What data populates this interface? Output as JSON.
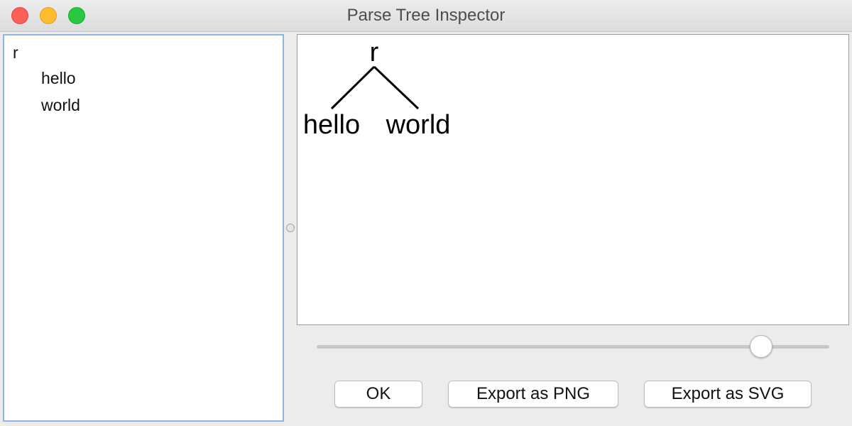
{
  "window": {
    "title": "Parse Tree Inspector"
  },
  "tree_list": {
    "root": "r",
    "children": [
      "hello",
      "world"
    ]
  },
  "tree_view": {
    "root_label": "r",
    "left_child_label": "hello",
    "right_child_label": "world"
  },
  "zoom_slider": {
    "value_fraction": 0.87
  },
  "buttons": {
    "ok": "OK",
    "export_png": "Export as PNG",
    "export_svg": "Export as SVG"
  },
  "colors": {
    "close": "#fd5f57",
    "minimize": "#fdbc2e",
    "zoom": "#28c840",
    "tree_pane_border": "#8fb6de"
  }
}
